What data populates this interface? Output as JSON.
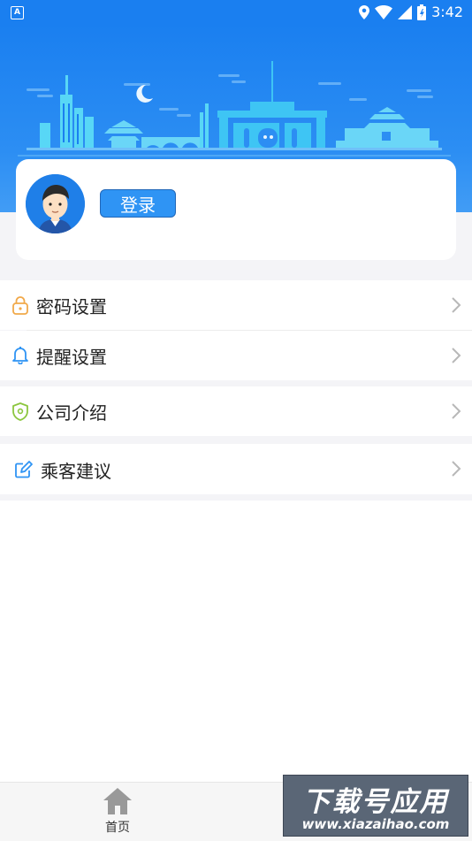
{
  "status_bar": {
    "time": "3:42",
    "notification_icon": "A"
  },
  "colors": {
    "header_blue": "#1a7ff0",
    "login_button": "#2f94f4",
    "lock_icon": "#f1a94a",
    "bell_icon": "#2f94f4",
    "shield_icon": "#8cc63f",
    "edit_icon": "#2f94f4"
  },
  "profile": {
    "login_label": "登录"
  },
  "menu": {
    "items": [
      {
        "label": "密码设置",
        "icon": "lock-icon"
      },
      {
        "label": "提醒设置",
        "icon": "bell-icon"
      },
      {
        "label": "公司介绍",
        "icon": "shield-icon"
      },
      {
        "label": "乘客建议",
        "icon": "edit-icon"
      }
    ]
  },
  "bottom_nav": {
    "home_label": "首页"
  },
  "watermark": {
    "title": "下载号应用",
    "url": "www.xiazaihao.com"
  }
}
